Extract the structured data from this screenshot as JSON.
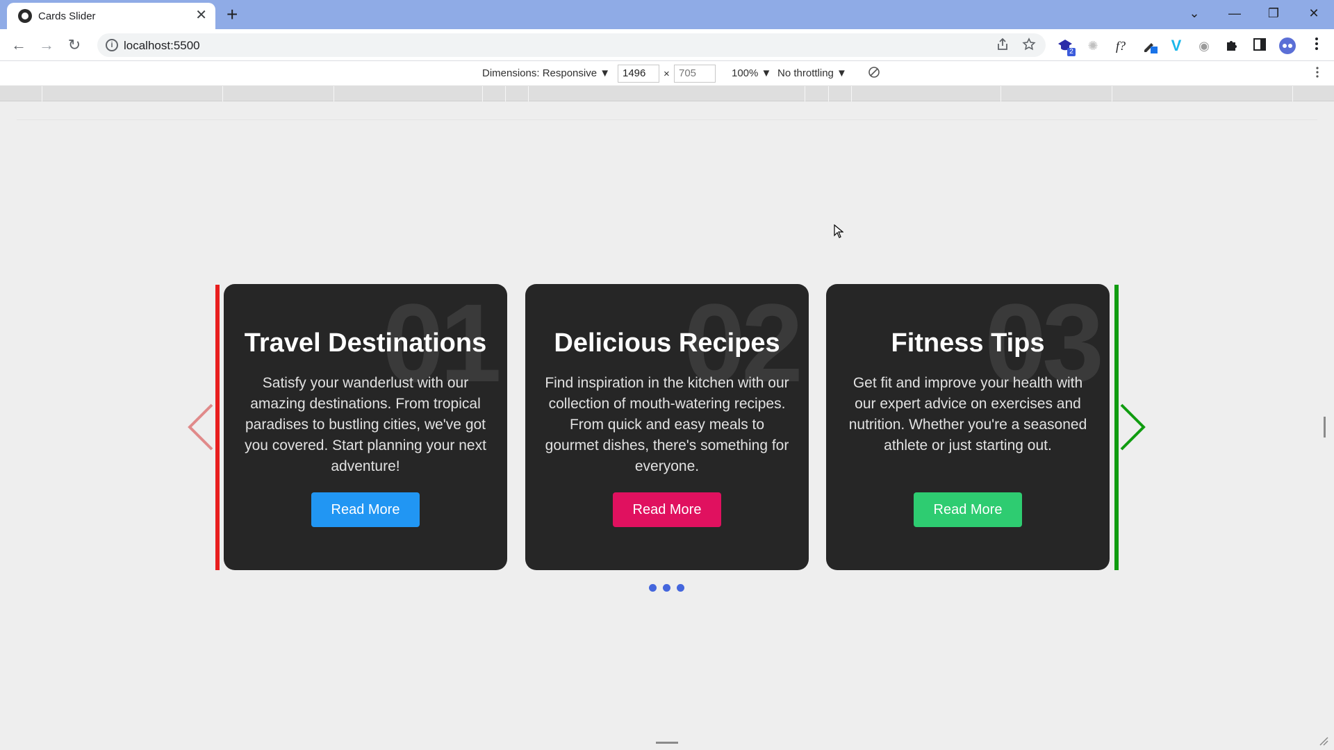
{
  "browser": {
    "tab_title": "Cards Slider",
    "tab_close": "✕",
    "new_tab": "+",
    "url": "localhost:5500",
    "info_glyph": "i",
    "window_controls": {
      "list": "⌄",
      "minimize": "—",
      "restore": "❐",
      "close": "✕"
    },
    "nav": {
      "back": "←",
      "forward": "→",
      "reload": "↻"
    },
    "ext_badge": "2",
    "ext_formula": "f?",
    "ext_v": "V"
  },
  "devtools": {
    "dimensions_label": "Dimensions: Responsive ▼",
    "width": "1496",
    "times": "×",
    "height": "705",
    "zoom": "100% ▼",
    "throttling": "No throttling ▼"
  },
  "slider": {
    "colors": {
      "left_edge": "#e81e1e",
      "right_edge": "#109c10",
      "prev_arrow": "#e08a8a",
      "next_arrow": "#109c10",
      "dots": "#4466dd"
    },
    "cards": [
      {
        "number": "01",
        "title": "Travel Destinations",
        "text": "Satisfy your wanderlust with our amazing destinations. From tropical paradises to bustling cities, we've got you covered. Start planning your next adventure!",
        "button": "Read More",
        "button_color": "#2196f3"
      },
      {
        "number": "02",
        "title": "Delicious Recipes",
        "text": "Find inspiration in the kitchen with our collection of mouth-watering recipes. From quick and easy meals to gourmet dishes, there's something for everyone.",
        "button": "Read More",
        "button_color": "#e0115f"
      },
      {
        "number": "03",
        "title": "Fitness Tips",
        "text": "Get fit and improve your health with our expert advice on exercises and nutrition. Whether you're a seasoned athlete or just starting out.",
        "button": "Read More",
        "button_color": "#2ecc71"
      }
    ],
    "pagination_count": 3
  }
}
